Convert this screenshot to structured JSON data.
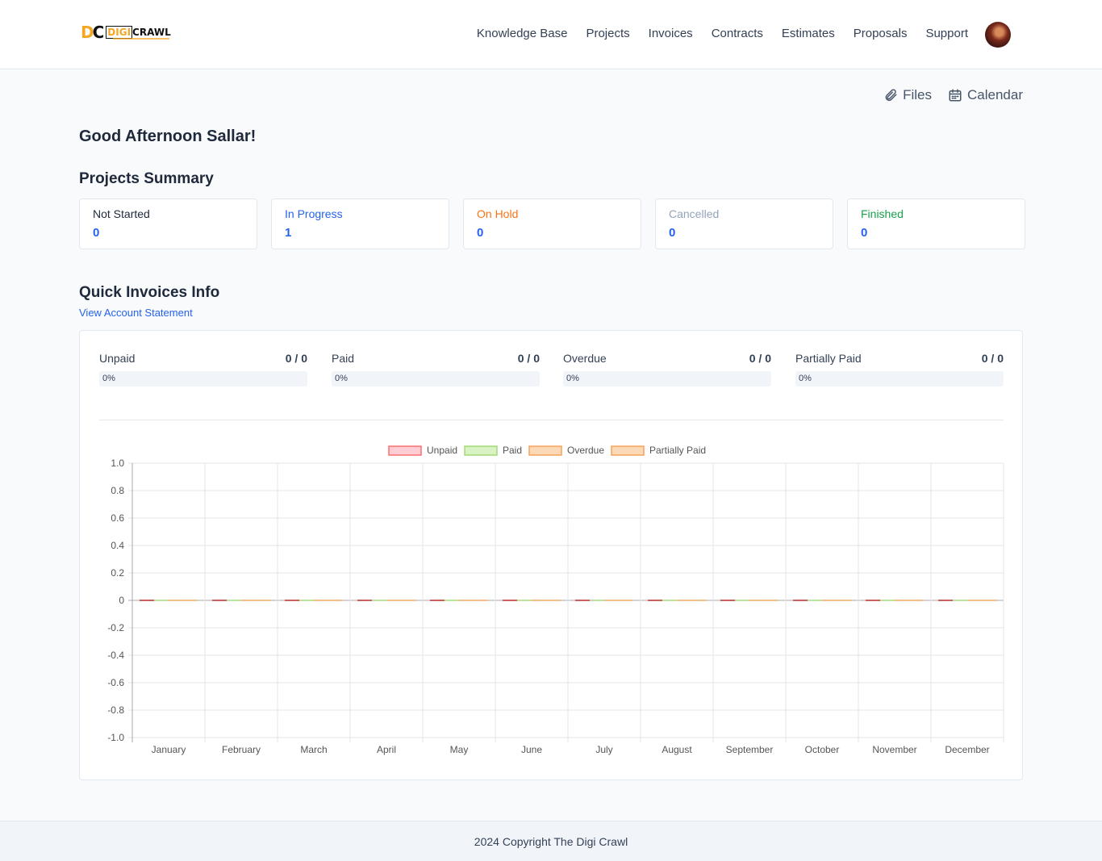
{
  "header": {
    "logo_text": "DIGICRAWL",
    "nav": [
      "Knowledge Base",
      "Projects",
      "Invoices",
      "Contracts",
      "Estimates",
      "Proposals",
      "Support"
    ]
  },
  "quick_links": {
    "files": "Files",
    "calendar": "Calendar"
  },
  "greeting": "Good Afternoon Sallar!",
  "projects_summary": {
    "title": "Projects Summary",
    "cards": [
      {
        "label": "Not Started",
        "count": "0",
        "color": "#1e293b"
      },
      {
        "label": "In Progress",
        "count": "1",
        "color": "#2563eb"
      },
      {
        "label": "On Hold",
        "count": "0",
        "color": "#f97316"
      },
      {
        "label": "Cancelled",
        "count": "0",
        "color": "#94a3b8"
      },
      {
        "label": "Finished",
        "count": "0",
        "color": "#16a34a"
      }
    ]
  },
  "invoices": {
    "title": "Quick Invoices Info",
    "statement_link": "View Account Statement",
    "stats": [
      {
        "label": "Unpaid",
        "ratio": "0 / 0",
        "percent": "0%",
        "progress": 0
      },
      {
        "label": "Paid",
        "ratio": "0 / 0",
        "percent": "0%",
        "progress": 0
      },
      {
        "label": "Overdue",
        "ratio": "0 / 0",
        "percent": "0%",
        "progress": 0
      },
      {
        "label": "Partially Paid",
        "ratio": "0 / 0",
        "percent": "0%",
        "progress": 0
      }
    ]
  },
  "chart_data": {
    "type": "bar",
    "categories": [
      "January",
      "February",
      "March",
      "April",
      "May",
      "June",
      "July",
      "August",
      "September",
      "October",
      "November",
      "December"
    ],
    "series": [
      {
        "name": "Unpaid",
        "values": [
          0,
          0,
          0,
          0,
          0,
          0,
          0,
          0,
          0,
          0,
          0,
          0
        ],
        "color": "#f87171",
        "fill": "#fecdd3"
      },
      {
        "name": "Paid",
        "values": [
          0,
          0,
          0,
          0,
          0,
          0,
          0,
          0,
          0,
          0,
          0,
          0
        ],
        "color": "#a3d977",
        "fill": "#d9f2c4"
      },
      {
        "name": "Overdue",
        "values": [
          0,
          0,
          0,
          0,
          0,
          0,
          0,
          0,
          0,
          0,
          0,
          0
        ],
        "color": "#f5a35c",
        "fill": "#fcd9b6"
      },
      {
        "name": "Partially Paid",
        "values": [
          0,
          0,
          0,
          0,
          0,
          0,
          0,
          0,
          0,
          0,
          0,
          0
        ],
        "color": "#f5a35c",
        "fill": "#fcd9b6"
      }
    ],
    "yticks": [
      "1.0",
      "0.8",
      "0.6",
      "0.4",
      "0.2",
      "0",
      "-0.2",
      "-0.4",
      "-0.6",
      "-0.8",
      "-1.0"
    ],
    "ylim": [
      -1,
      1
    ],
    "grid": true,
    "legend": "top"
  },
  "footer": "2024 Copyright The Digi Crawl"
}
